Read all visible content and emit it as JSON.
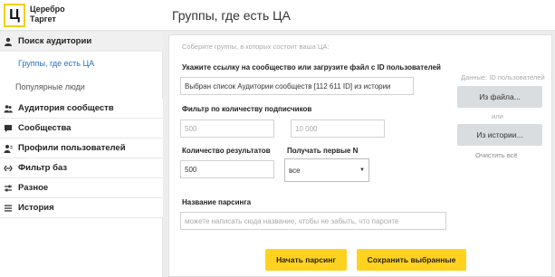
{
  "app": {
    "logo_letter": "Ц",
    "logo_line1": "Церебро",
    "logo_line2": "Таргет",
    "page_title": "Группы, где есть ЦА"
  },
  "sidebar": {
    "items": [
      {
        "label": "Поиск аудитории",
        "icon": "user-search-icon"
      },
      {
        "label": "Аудитория сообществ",
        "icon": "people-icon"
      },
      {
        "label": "Сообщества",
        "icon": "chat-icon"
      },
      {
        "label": "Профили пользователей",
        "icon": "profiles-icon"
      },
      {
        "label": "Фильтр баз",
        "icon": "filter-icon"
      },
      {
        "label": "Разное",
        "icon": "sliders-icon"
      },
      {
        "label": "История",
        "icon": "list-icon"
      }
    ],
    "subitems": [
      {
        "label": "Группы, где есть ЦА",
        "selected": true
      },
      {
        "label": "Популярные люди",
        "selected": false
      }
    ]
  },
  "form": {
    "intro": "Соберите группы, в которых состоит ваша ЦА:",
    "source_label": "Укажите ссылку на сообщество или загрузите файл с ID пользователей",
    "source_value": "Выбран список Аудитории сообществ [112 611 ID] из истории",
    "filter_label": "Фильтр по количеству подписчиков",
    "filter_min_placeholder": "500",
    "filter_max_placeholder": "10 000",
    "count_label": "Количество результатов",
    "count_value": "500",
    "first_n_label": "Получать первые N",
    "first_n_value": "все",
    "name_label": "Название парсинга",
    "name_placeholder": "можете написать сюда название, чтобы не забыть, что парсите"
  },
  "side_actions": {
    "data_info": "Данные: ID пользователей",
    "from_file": "Из файла...",
    "or": "или",
    "from_history": "Из истории...",
    "clear_all": "Очистить всё"
  },
  "actions": {
    "start": "Начать парсинг",
    "save": "Сохранить выбранные"
  },
  "colors": {
    "accent_yellow": "#ffd21f",
    "link_blue": "#1f73c9",
    "button_grey": "#d9dde0"
  }
}
